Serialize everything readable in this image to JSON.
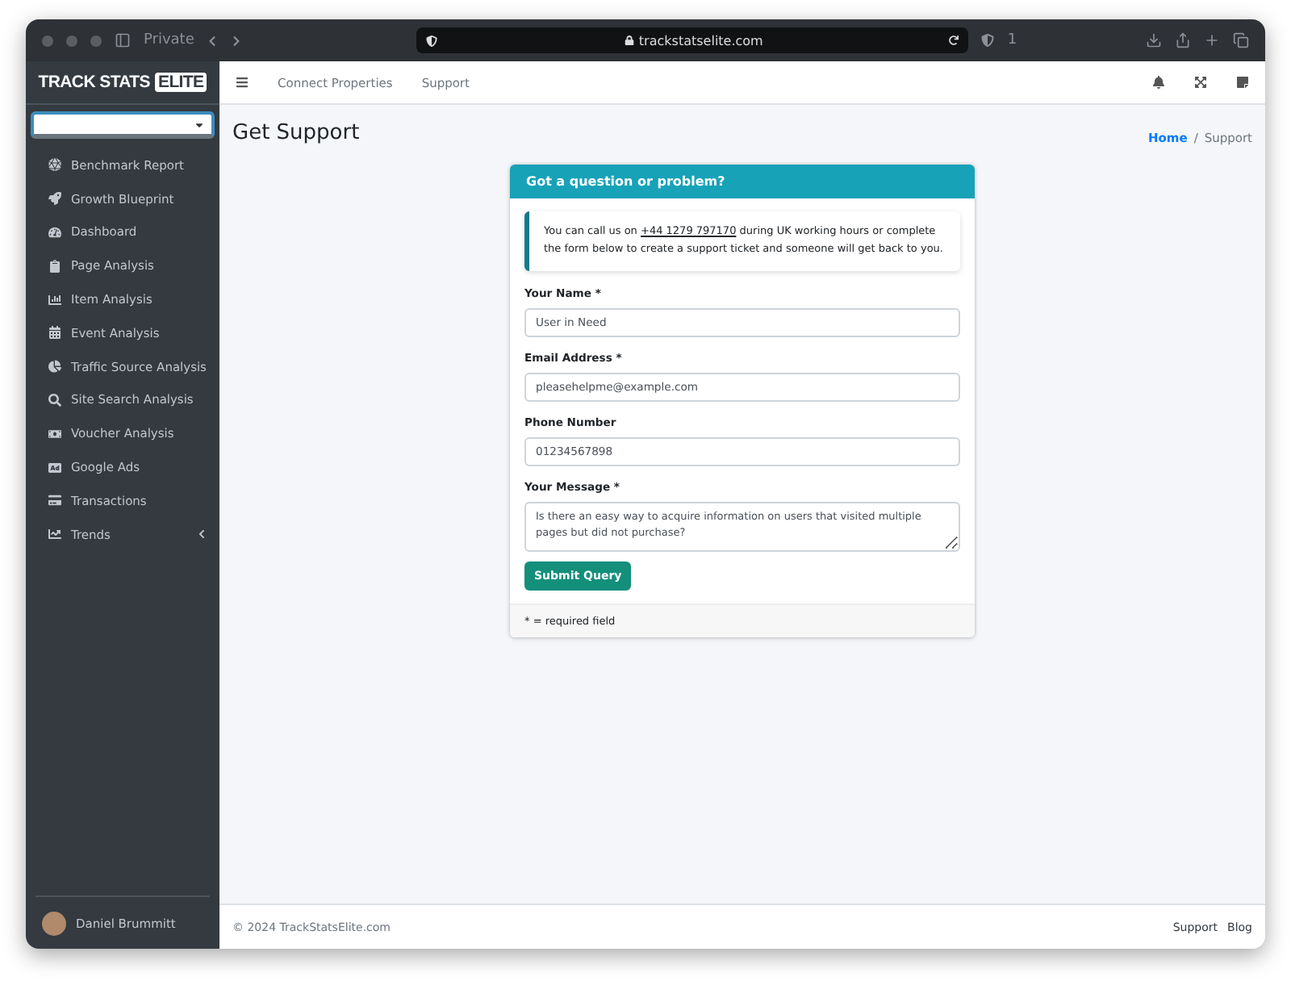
{
  "browser": {
    "tab_label": "Private",
    "url": "trackstatselite.com",
    "shield_count": "1"
  },
  "sidebar": {
    "logo": {
      "text": "TRACK STATS",
      "badge": "ELITE"
    },
    "items": [
      {
        "label": "Benchmark Report",
        "kind": "link"
      },
      {
        "label": "Growth Blueprint",
        "kind": "link"
      },
      {
        "label": "Dashboard",
        "kind": "link"
      },
      {
        "label": "Page Analysis",
        "kind": "link"
      },
      {
        "label": "Item Analysis",
        "kind": "link"
      },
      {
        "label": "Event Analysis",
        "kind": "link"
      },
      {
        "label": "Traffic Source Analysis",
        "kind": "link"
      },
      {
        "label": "Site Search Analysis",
        "kind": "link"
      },
      {
        "label": "Voucher Analysis",
        "kind": "link"
      },
      {
        "label": "Google Ads",
        "kind": "link"
      },
      {
        "label": "Transactions",
        "kind": "link"
      },
      {
        "label": "Trends",
        "kind": "group",
        "expanded": false
      }
    ],
    "user": {
      "name": "Daniel Brummitt"
    }
  },
  "navbar": {
    "links": [
      "Connect Properties",
      "Support"
    ]
  },
  "page": {
    "title": "Get Support",
    "breadcrumb_separator": "/",
    "breadcrumb": [
      {
        "label": "Home",
        "link": true
      },
      {
        "label": "Support",
        "link": false
      }
    ]
  },
  "card": {
    "header": "Got a question or problem?",
    "callout": {
      "before": "You can call us on",
      "phone": "+44 1279 797170",
      "after": "during UK working hours or complete the form below to create a support ticket and someone will get back to you."
    },
    "fields": [
      {
        "label": "Your Name *",
        "value": "User in Need",
        "kind": "input"
      },
      {
        "label": "Email Address *",
        "value": "pleasehelpme@example.com",
        "kind": "input"
      },
      {
        "label": "Phone Number",
        "value": "01234567898",
        "kind": "input"
      },
      {
        "label": "Your Message *",
        "value": "Is there an easy way to acquire information on users that visited multiple pages but did not purchase?",
        "kind": "textarea"
      }
    ],
    "submit": "Submit Query",
    "footer": "* = required field"
  },
  "footer": {
    "copyright": "© 2024 TrackStatsElite.com",
    "links": [
      "Support",
      "Blog"
    ]
  }
}
